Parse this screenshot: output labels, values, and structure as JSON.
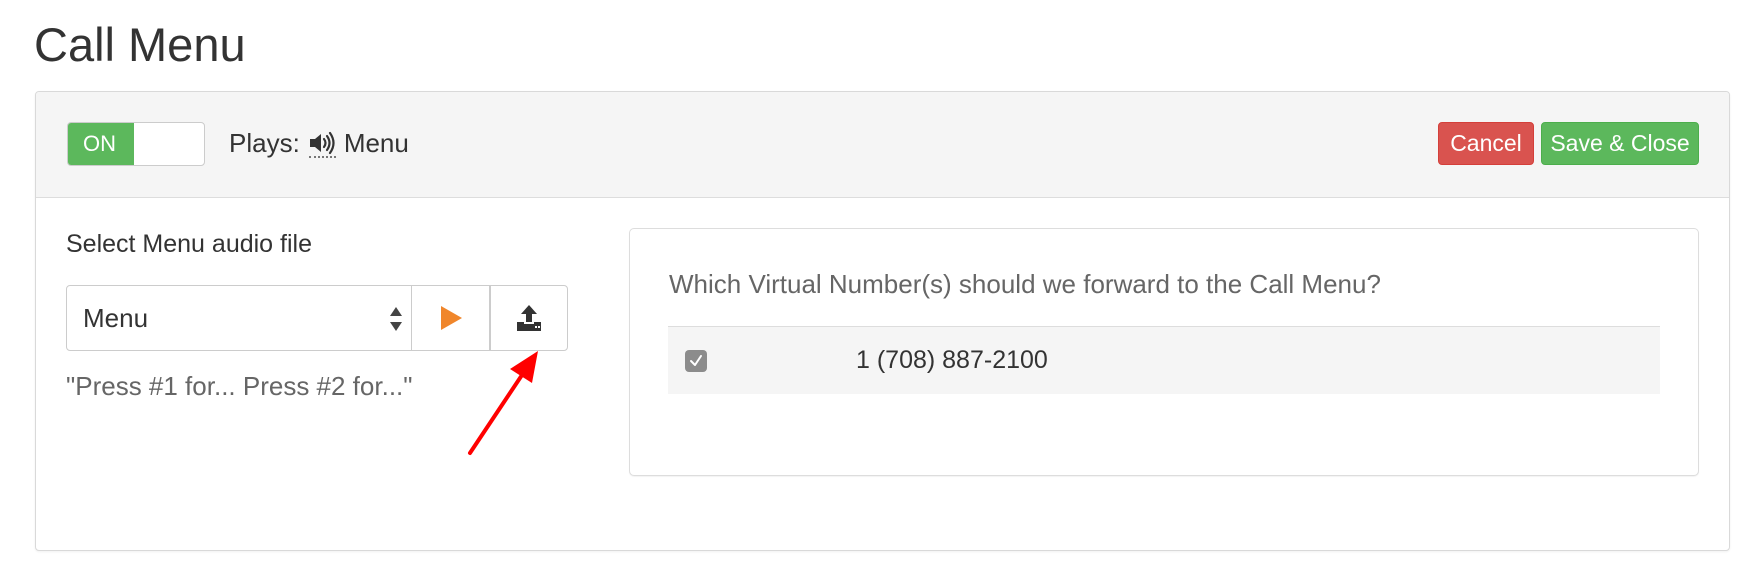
{
  "page": {
    "title": "Call Menu"
  },
  "header": {
    "toggle_label": "ON",
    "plays_label": "Plays:",
    "plays_value": "Menu",
    "cancel_label": "Cancel",
    "save_label": "Save & Close"
  },
  "audio": {
    "select_label": "Select Menu audio file",
    "selected_value": "Menu",
    "description": "\"Press #1 for... Press #2 for...\""
  },
  "numbers": {
    "question": "Which Virtual Number(s) should we forward to the Call Menu?",
    "rows": [
      {
        "number": "1 (708) 887-2100",
        "checked": true
      }
    ]
  },
  "colors": {
    "on_green": "#5cb85c",
    "cancel_red": "#d9534f",
    "play_orange": "#f0862b",
    "annotation_red": "#ff0000"
  },
  "icons": {
    "speaker": "speaker-icon",
    "play": "play-icon",
    "upload": "upload-icon",
    "check": "check-icon",
    "select_arrows": "select-arrows-icon"
  }
}
